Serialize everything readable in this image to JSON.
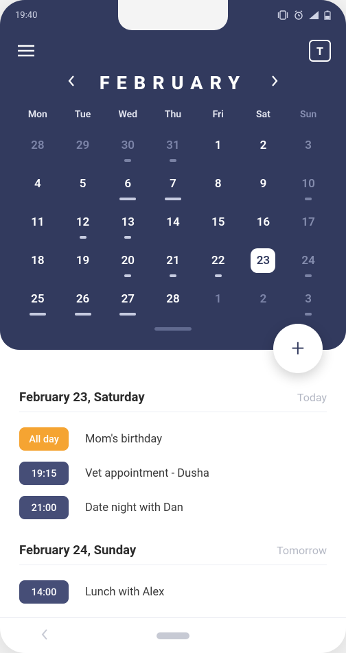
{
  "status": {
    "time": "19:40"
  },
  "topbar": {
    "today_glyph": "T"
  },
  "calendar": {
    "month_label": "FEBRUARY",
    "weekdays": [
      "Mon",
      "Tue",
      "Wed",
      "Thu",
      "Fri",
      "Sat",
      "Sun"
    ],
    "weeks": [
      [
        {
          "n": "28",
          "out": true
        },
        {
          "n": "29",
          "out": true
        },
        {
          "n": "30",
          "out": true,
          "mark": "dot5"
        },
        {
          "n": "31",
          "out": true,
          "mark": "dot5"
        },
        {
          "n": "1"
        },
        {
          "n": "2"
        },
        {
          "n": "3",
          "sun": true
        }
      ],
      [
        {
          "n": "4"
        },
        {
          "n": "5"
        },
        {
          "n": "6",
          "mark": "dot10"
        },
        {
          "n": "7",
          "mark": "dot10"
        },
        {
          "n": "8"
        },
        {
          "n": "9"
        },
        {
          "n": "10",
          "sun": true,
          "mark": "dot5"
        }
      ],
      [
        {
          "n": "11"
        },
        {
          "n": "12",
          "mark": "dot5"
        },
        {
          "n": "13",
          "mark": "dot5"
        },
        {
          "n": "14"
        },
        {
          "n": "15"
        },
        {
          "n": "16"
        },
        {
          "n": "17",
          "sun": true
        }
      ],
      [
        {
          "n": "18"
        },
        {
          "n": "19"
        },
        {
          "n": "20",
          "mark": "dot5"
        },
        {
          "n": "21",
          "mark": "dot5"
        },
        {
          "n": "22",
          "mark": "dot5"
        },
        {
          "n": "23",
          "selected": true
        },
        {
          "n": "24",
          "sun": true,
          "mark": "dot5"
        }
      ],
      [
        {
          "n": "25",
          "mark": "dot10"
        },
        {
          "n": "26",
          "mark": "dot10"
        },
        {
          "n": "27",
          "mark": "dot10"
        },
        {
          "n": "28"
        },
        {
          "n": "1",
          "out": true
        },
        {
          "n": "2",
          "out": true
        },
        {
          "n": "3",
          "out": true,
          "sun": true,
          "mark": "dot5"
        }
      ]
    ]
  },
  "agenda": {
    "sections": [
      {
        "title": "February 23, Saturday",
        "rel": "Today",
        "events": [
          {
            "time": "All day",
            "allday": true,
            "title": "Mom's birthday"
          },
          {
            "time": "19:15",
            "title": "Vet appointment - Dusha"
          },
          {
            "time": "21:00",
            "title": "Date night with Dan"
          }
        ]
      },
      {
        "title": "February 24, Sunday",
        "rel": "Tomorrow",
        "events": [
          {
            "time": "14:00",
            "title": "Lunch with Alex"
          }
        ]
      }
    ]
  },
  "fab": {
    "glyph": "+"
  }
}
